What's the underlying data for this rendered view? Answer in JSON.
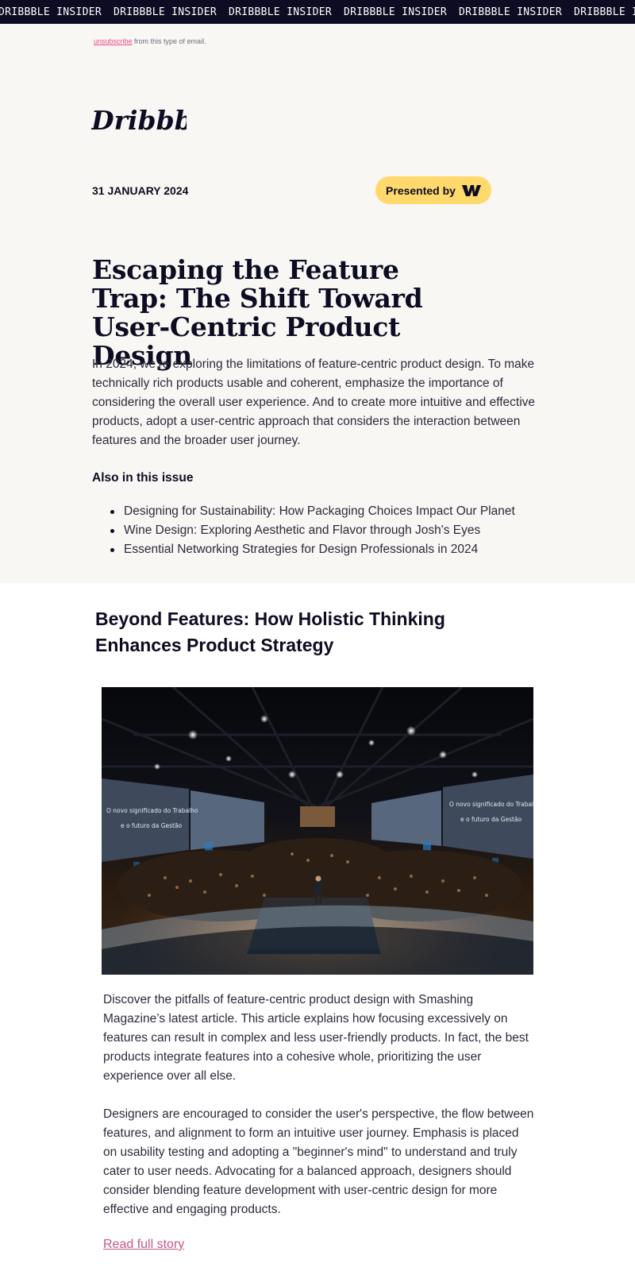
{
  "banner": {
    "items": [
      "DRIBBBLE INSIDER",
      "DRIBBBLE INSIDER",
      "DRIBBBLE INSIDER",
      "DRIBBBLE INSIDER",
      "DRIBBBLE INSIDER",
      "DRIBBBLE INSIDER"
    ]
  },
  "header": {
    "unsubscribe_link": "unsubscribe",
    "unsubscribe_suffix": " from this type of email.",
    "logo_text": "Dribbble",
    "date": "31 JANUARY 2024",
    "presented_by": "Presented by"
  },
  "hero": {
    "title": "Escaping the Feature Trap: The Shift Toward User-Centric Product Design",
    "intro": "In 2024, we’re exploring the limitations of feature-centric product design. To make technically rich products usable and coherent, emphasize the importance of considering the overall user experience. And to create more intuitive and effective products, adopt a user-centric approach that considers the interaction between features and the broader user journey."
  },
  "also": {
    "heading": "Also in this issue",
    "items": [
      "Designing for Sustainability: How Packaging Choices Impact Our Planet",
      "Wine Design: Exploring Aesthetic and Flavor through Josh's Eyes",
      "Essential Networking Strategies for Design Professionals in 2024"
    ]
  },
  "article": {
    "title": "Beyond Features: How Holistic Thinking Enhances Product Strategy",
    "screen_left_line1": "O novo significado do Trabalho",
    "screen_left_line2": "e o futuro da Gestão",
    "screen_right_line1": "O novo significado do Trabalho",
    "screen_right_line2": "e o futuro da Gestão",
    "paragraph1": "Discover the pitfalls of feature-centric product design with Smashing Magazine’s latest article. This article explains how focusing excessively on features can result in complex and less user-friendly products. In fact, the best products integrate features into a cohesive whole, prioritizing the user experience over all else.",
    "paragraph2": "Designers are encouraged to consider the user's perspective, the flow between features, and alignment to form an intuitive user journey. Emphasis is placed on usability testing and adopting a \"beginner's mind\" to understand and truly cater to user needs. Advocating for a balanced approach, designers should consider blending feature development with user-centric design for more effective and engaging products.",
    "read_more": "Read full story"
  },
  "colors": {
    "banner_bg": "#0d0c22",
    "hero_bg": "#f8f7f4",
    "sponsor_pill": "#ffd96b",
    "link_pink": "#ea4c89"
  },
  "icons": {
    "sponsor_logo": "webflow-w-icon",
    "brand_logo": "dribbble-wordmark"
  }
}
